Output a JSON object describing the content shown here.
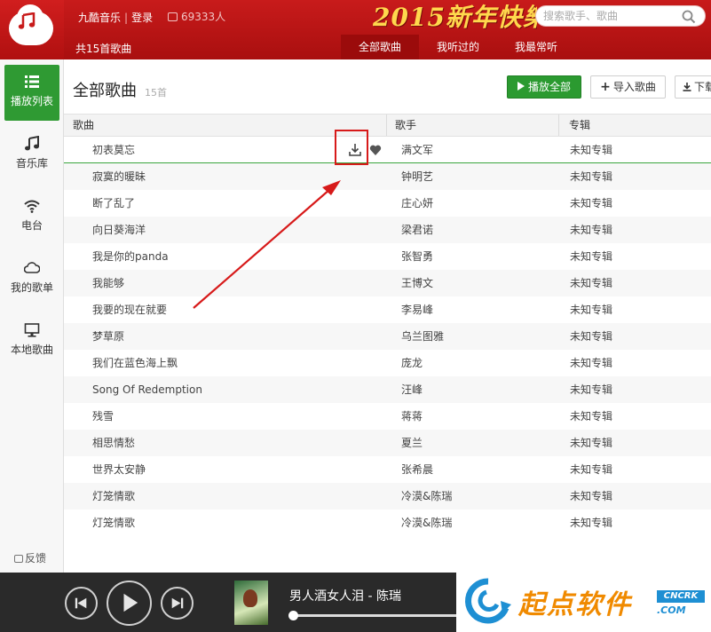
{
  "header": {
    "app_name": "九酷音乐",
    "separator": "|",
    "login": "登录",
    "online_count": "69333人",
    "banner_text": "2015新年快樂",
    "search_placeholder": "搜索歌手、歌曲",
    "total_songs_label": "共15首歌曲",
    "tabs": [
      {
        "label": "全部歌曲",
        "active": true
      },
      {
        "label": "我听过的",
        "active": false
      },
      {
        "label": "我最常听",
        "active": false
      }
    ]
  },
  "sidebar": {
    "items": [
      {
        "label": "播放列表",
        "icon": "list-icon",
        "active": true
      },
      {
        "label": "音乐库",
        "icon": "music-note-icon",
        "active": false
      },
      {
        "label": "电台",
        "icon": "wifi-icon",
        "active": false
      },
      {
        "label": "我的歌单",
        "icon": "cloud-icon",
        "active": false
      },
      {
        "label": "本地歌曲",
        "icon": "monitor-icon",
        "active": false
      }
    ],
    "feedback": "反馈"
  },
  "main": {
    "title": "全部歌曲",
    "count": "15首",
    "buttons": {
      "play_all": "播放全部",
      "import": "导入歌曲",
      "download": "下载"
    },
    "columns": [
      "歌曲",
      "歌手",
      "专辑"
    ],
    "rows": [
      {
        "song": "初表莫忘",
        "artist": "满文军",
        "album": "未知专辑"
      },
      {
        "song": "寂寞的暖昧",
        "artist": "钟明艺",
        "album": "未知专辑"
      },
      {
        "song": "断了乱了",
        "artist": "庄心妍",
        "album": "未知专辑"
      },
      {
        "song": "向日葵海洋",
        "artist": "梁君诺",
        "album": "未知专辑"
      },
      {
        "song": "我是你的panda",
        "artist": "张智勇",
        "album": "未知专辑"
      },
      {
        "song": "我能够",
        "artist": "王博文",
        "album": "未知专辑"
      },
      {
        "song": "我要的现在就要",
        "artist": "李易峰",
        "album": "未知专辑"
      },
      {
        "song": "梦草原",
        "artist": "乌兰图雅",
        "album": "未知专辑"
      },
      {
        "song": "我们在蓝色海上飘",
        "artist": "庞龙",
        "album": "未知专辑"
      },
      {
        "song": "Song Of Redemption",
        "artist": "汪峰",
        "album": "未知专辑"
      },
      {
        "song": "残雪",
        "artist": "蒋蒋",
        "album": "未知专辑"
      },
      {
        "song": "相思情愁",
        "artist": "夏兰",
        "album": "未知专辑"
      },
      {
        "song": "世界太安静",
        "artist": "张希晨",
        "album": "未知专辑"
      },
      {
        "song": "灯笼情歌",
        "artist": "冷漠&陈瑞",
        "album": "未知专辑"
      },
      {
        "song": "灯笼情歌",
        "artist": "冷漠&陈瑞",
        "album": "未知专辑"
      }
    ]
  },
  "player": {
    "now_playing": "男人酒女人泪 - 陈瑞",
    "progress": 0
  },
  "watermark": {
    "text": "起点软件",
    "badge": "CNCRK",
    "domain": ".COM"
  },
  "colors": {
    "header_red": "#b81414",
    "accent_green": "#2b9a30",
    "annotation_red": "#d71a1a",
    "player_bg": "#2a2a2a"
  }
}
